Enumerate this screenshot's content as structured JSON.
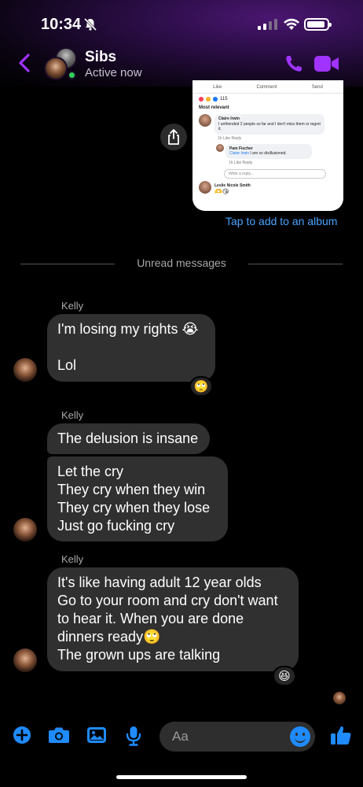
{
  "status_bar": {
    "time": "10:34"
  },
  "header": {
    "name": "Sibs",
    "status": "Active now"
  },
  "shared_image": {
    "like": "Like",
    "comment": "Comment",
    "send": "Send",
    "reaction_count": "115",
    "sort": "Most relevant",
    "comments": [
      {
        "author": "Claire Irwin",
        "text": "I unfriended 2 people so far and I don't miss them or regret it.",
        "meta": "1h   Like   Reply"
      },
      {
        "author": "Pam Fischer",
        "mention": "Claire Irwin",
        "text": " I am so disillusioned.",
        "meta": "1h   Like   Reply"
      }
    ],
    "reply_placeholder": "Write a reply...",
    "last_author": "Leslie Nicole Smith",
    "last_emojis": "🫶😘"
  },
  "album_link": "Tap to add to an album",
  "divider_label": "Unread messages",
  "groups": [
    {
      "sender": "Kelly",
      "messages": [
        {
          "lines": [
            "I'm losing my rights 😭",
            "",
            "Lol"
          ]
        }
      ],
      "reaction": "🙄"
    },
    {
      "sender": "Kelly",
      "messages": [
        {
          "lines": [
            "The delusion is insane"
          ]
        },
        {
          "lines": [
            "Let the cry",
            "They cry when they win",
            "They cry when they lose",
            "Just go fucking cry"
          ]
        }
      ]
    },
    {
      "sender": "Kelly",
      "messages": [
        {
          "lines": [
            "It's like having adult 12 year olds",
            "Go to your room and cry don't want",
            "to hear it.  When you are done",
            "dinners ready🙄",
            "The grown ups are talking"
          ]
        }
      ],
      "reaction": "😆"
    }
  ],
  "composer": {
    "placeholder": "Aa"
  },
  "colors": {
    "accent": "#a033ff",
    "link": "#4aa2ff",
    "bubble": "#303030",
    "composer_icon": "#1f8bff"
  }
}
